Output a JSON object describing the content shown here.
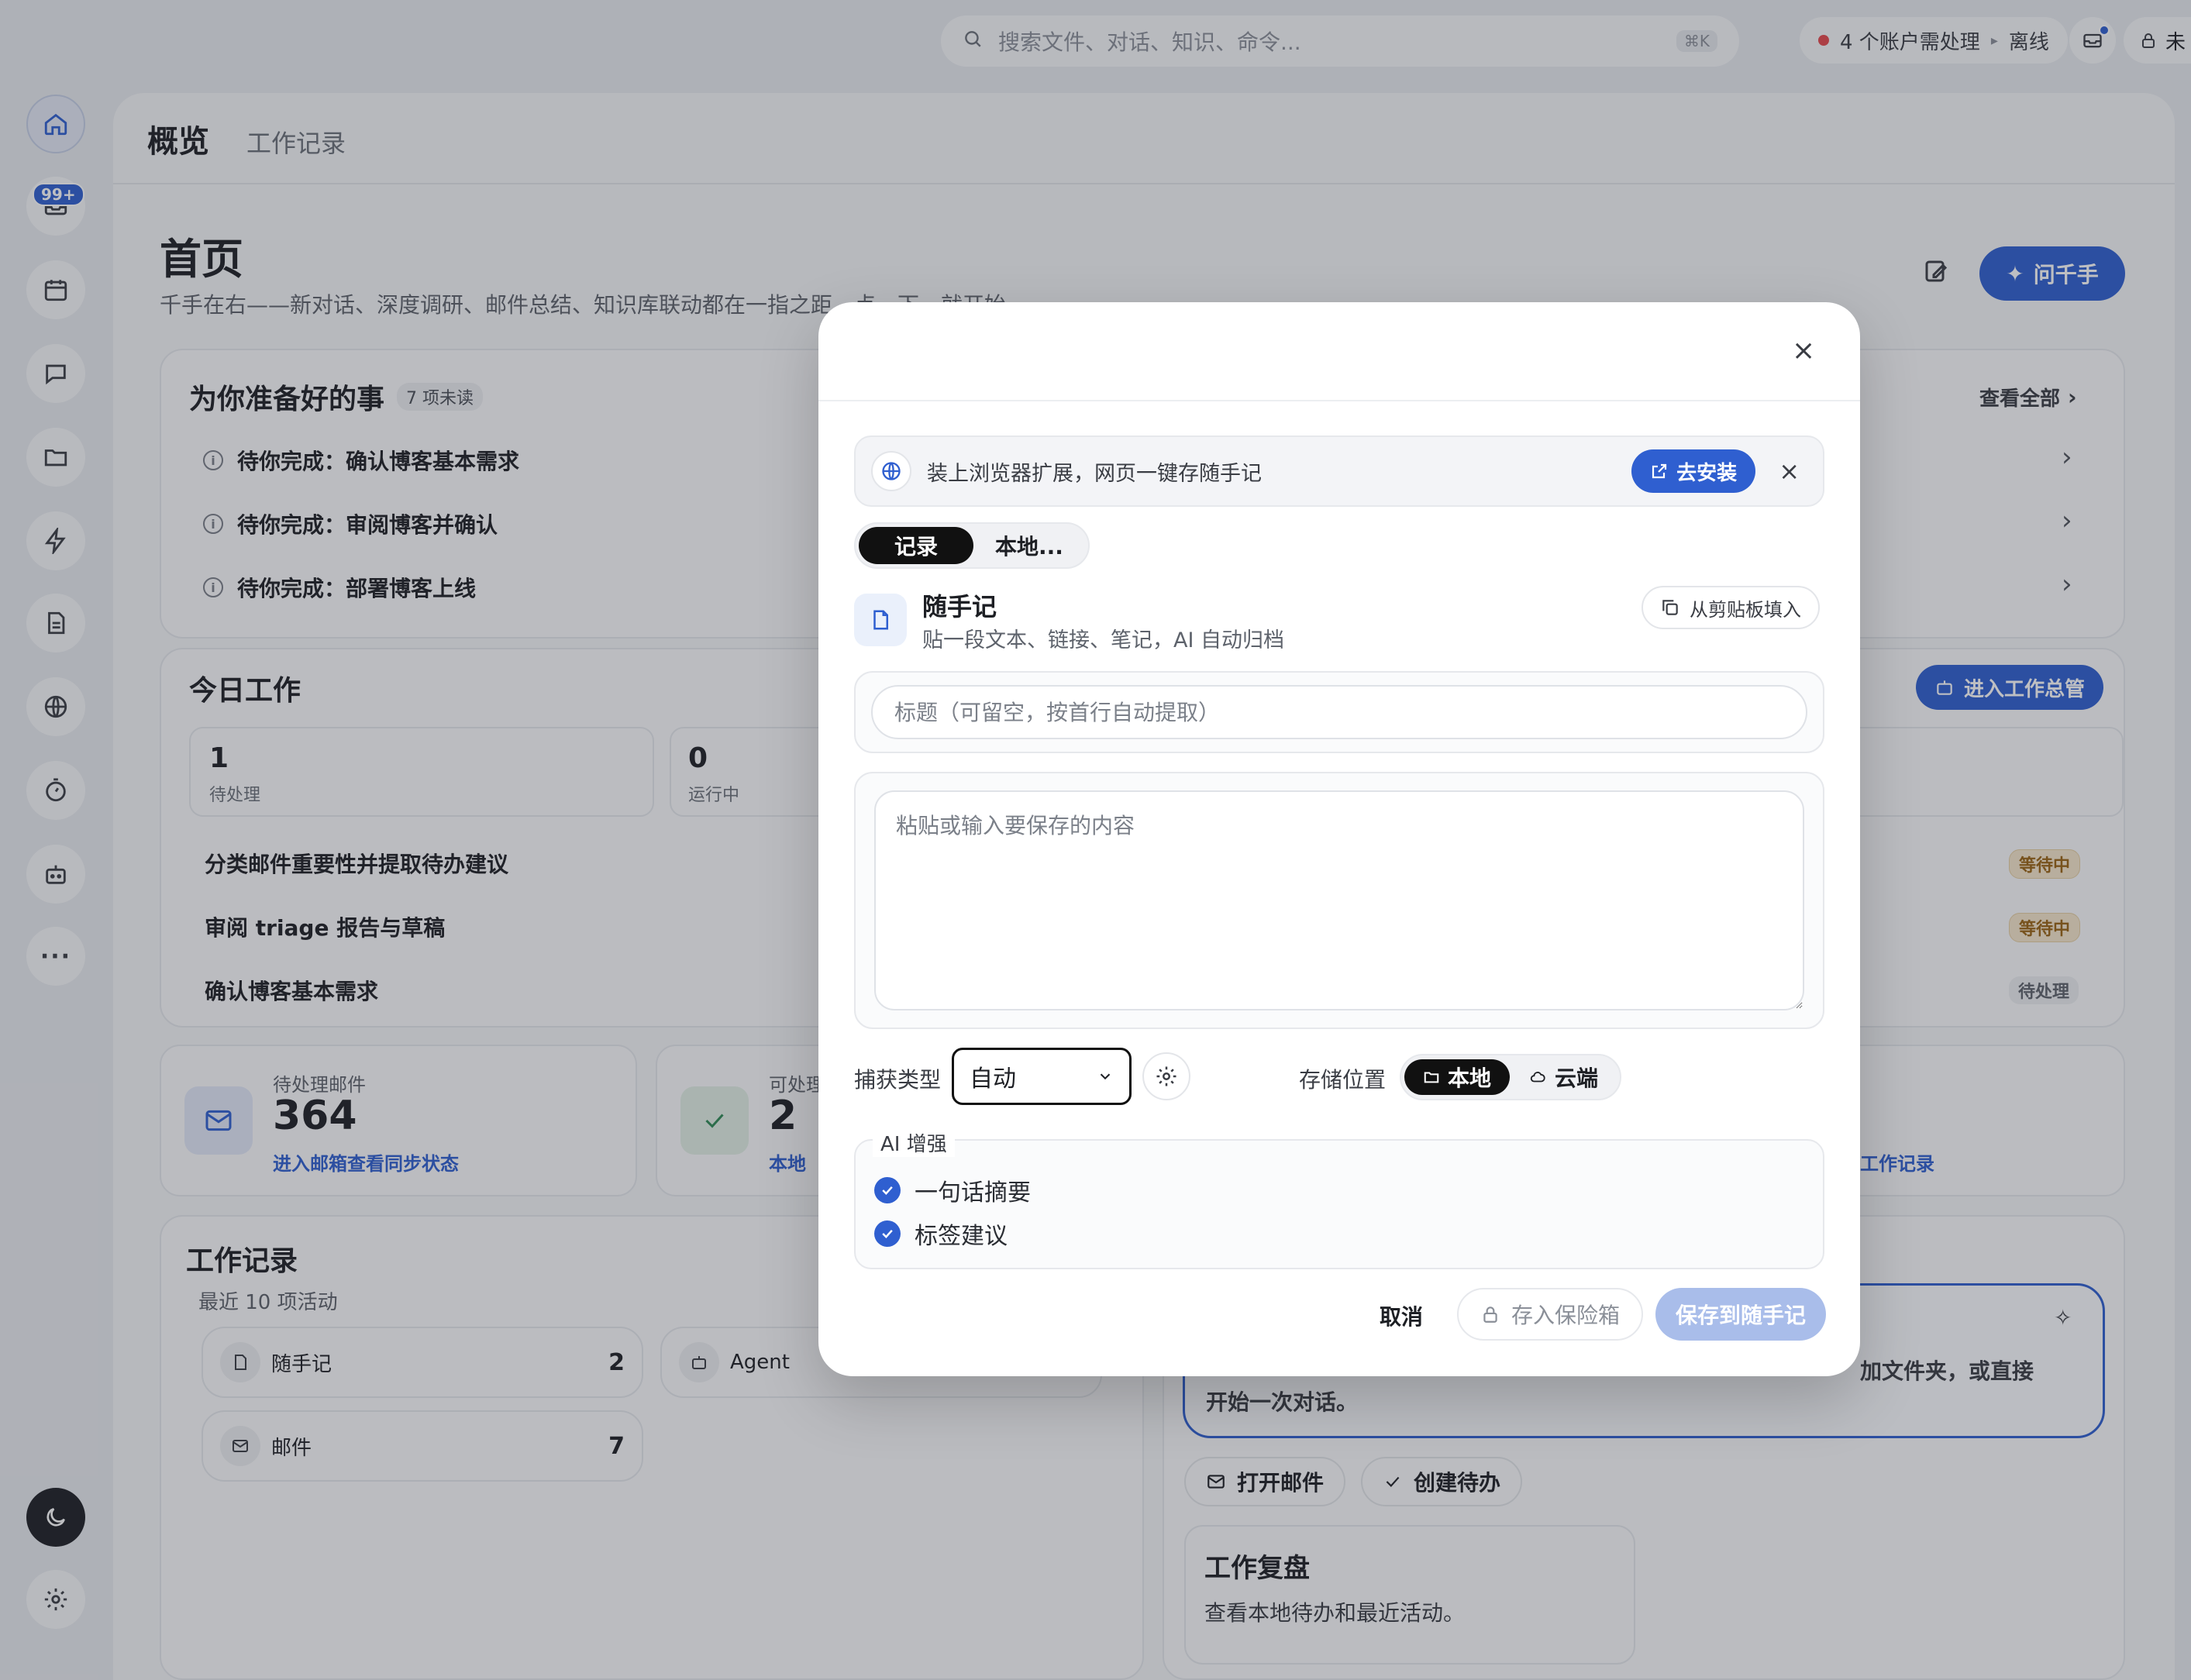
{
  "topbar": {
    "search_placeholder": "搜索文件、对话、知识、命令...",
    "search_shortcut": "⌘K",
    "accounts_notice": "4 个账户需处理",
    "offline_label": "离线",
    "lock_label": "未"
  },
  "rail": {
    "inbox_badge": "99+"
  },
  "tabs": {
    "overview": "概览",
    "worklog": "工作记录"
  },
  "page": {
    "title": "首页",
    "subtitle": "千手在右——新对话、深度调研、邮件总结、知识库联动都在一指之距，点一下，就开始。",
    "ask_button": "问千手"
  },
  "prepared": {
    "title": "为你准备好的事",
    "unread_badge": "7 项未读",
    "view_all": "查看全部",
    "items": [
      "待你完成：确认博客基本需求",
      "待你完成：审阅博客并确认",
      "待你完成：部署博客上线"
    ]
  },
  "today": {
    "title": "今日工作",
    "enter_button": "进入工作总管",
    "stats": [
      {
        "value": "1",
        "label": "待处理"
      },
      {
        "value": "0",
        "label": "运行中"
      }
    ],
    "tasks": [
      {
        "title": "分类邮件重要性并提取待办建议",
        "status": "等待中"
      },
      {
        "title": "审阅 triage 报告与草稿",
        "status": "等待中"
      },
      {
        "title": "确认博客基本需求",
        "status": "待处理"
      }
    ]
  },
  "summary_cards": [
    {
      "label": "待处理邮件",
      "value": "364",
      "link": "进入邮箱查看同步状态"
    },
    {
      "label": "可处理",
      "value": "2",
      "link": "本地"
    },
    {
      "link": "工作记录"
    }
  ],
  "worklog": {
    "title": "工作记录",
    "subtitle": "最近 10 项活动",
    "items": [
      {
        "label": "随手记",
        "count": "2"
      },
      {
        "label": "Agent",
        "count": ""
      },
      {
        "label": "邮件",
        "count": "7"
      }
    ]
  },
  "assistant": {
    "text_line1": "加文件夹，或直接",
    "text_line2": "开始一次对话。",
    "actions": [
      "打开邮件",
      "创建待办"
    ],
    "review_title": "工作复盘",
    "review_desc": "查看本地待办和最近活动。"
  },
  "modal": {
    "banner_text": "装上浏览器扩展，网页一键存随手记",
    "install_button": "去安装",
    "segments": [
      "记录",
      "本地..."
    ],
    "note_title": "随手记",
    "note_desc": "贴一段文本、链接、笔记，AI 自动归档",
    "paste_button": "从剪贴板填入",
    "title_placeholder": "标题（可留空，按首行自动提取）",
    "content_placeholder": "粘贴或输入要保存的内容",
    "capture_label": "捕获类型",
    "capture_value": "自动",
    "storage_label": "存储位置",
    "storage_options": [
      "本地",
      "云端"
    ],
    "ai_legend": "AI 增强",
    "ai_options": [
      "一句话摘要",
      "标签建议"
    ],
    "cancel": "取消",
    "vault": "存入保险箱",
    "save": "保存到随手记"
  }
}
